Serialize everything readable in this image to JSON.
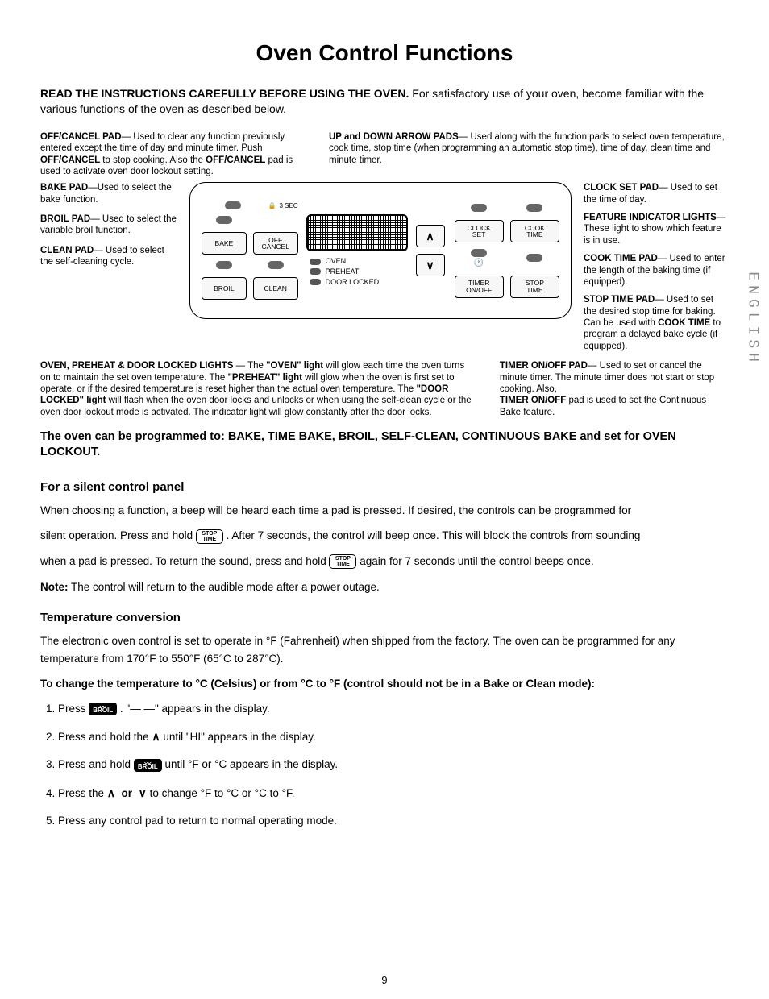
{
  "title": "Oven Control Functions",
  "intro_bold": "READ THE INSTRUCTIONS CAREFULLY BEFORE USING THE OVEN.",
  "intro_rest": " For satisfactory use of your oven, become familiar with the various functions of the oven as described below.",
  "top_row": {
    "off_cancel": {
      "label": "OFF/CANCEL PAD",
      "text": "— Used to clear any function previously entered except the time of day and minute timer. Push ",
      "b1": "OFF/CANCEL",
      "text2": " to stop cooking. Also the ",
      "b2": "OFF/CANCEL",
      "text3": " pad is used to activate oven door lockout setting."
    },
    "arrows": {
      "label": "UP and DOWN ARROW PADS",
      "text": "— Used along with the function pads to select oven temperature, cook time, stop time (when programming an automatic stop time), time of day, clean time and minute timer."
    }
  },
  "left": {
    "bake": {
      "label": "BAKE PAD",
      "text": "—Used to select the bake function."
    },
    "broil": {
      "label": "BROIL PAD",
      "text": "— Used to select the variable broil function."
    },
    "clean": {
      "label": "CLEAN PAD",
      "text": "— Used to select the self-cleaning cycle."
    }
  },
  "right": {
    "clock": {
      "label": "CLOCK SET PAD",
      "text": "— Used to set the time of day."
    },
    "feature": {
      "label": "FEATURE INDICATOR LIGHTS",
      "text": "— These light to show which feature is in use."
    },
    "cook": {
      "label": "COOK TIME PAD",
      "text": "— Used to enter the length of the baking time (if equipped)."
    },
    "stop": {
      "label": "STOP TIME PAD",
      "text": "— Used to set the desired stop time for baking. Can be used with ",
      "b": "COOK TIME",
      "text2": " to program a delayed bake cycle (if equipped)."
    }
  },
  "panel": {
    "pads": {
      "bake": "BAKE",
      "off": "OFF\nCANCEL",
      "broil": "BROIL",
      "clean": "CLEAN",
      "clock": "CLOCK\nSET",
      "cook": "COOK\nTIME",
      "timer": "TIMER\nON/OFF",
      "stop": "STOP\nTIME"
    },
    "sec_label": "3 SEC",
    "lights": {
      "oven": "OVEN",
      "preheat": "PREHEAT",
      "door": "DOOR LOCKED"
    }
  },
  "under": {
    "left": {
      "label": "OVEN, PREHEAT & DOOR LOCKED LIGHTS",
      "t1": " — The ",
      "b1": "\"OVEN\" light",
      "t2": " will glow each time the oven turns on to maintain the set oven temperature. The ",
      "b2": "\"PREHEAT\" light",
      "t3": " will glow when the oven is first set to operate, or if the desired temperature is reset higher than the actual oven temperature. The ",
      "b3": "\"DOOR LOCKED\" light",
      "t4": " will flash when the oven door locks and unlocks or when using the self-clean cycle or the oven door lockout mode is activated. The indicator light will glow constantly after the door locks."
    },
    "right": {
      "label": "TIMER ON/OFF PAD",
      "t1": "— Used to set or cancel the minute timer. The minute timer does not start or stop cooking. Also,",
      "br": "",
      "b1": "TIMER ON/OFF",
      "t2": " pad is used to set the Continuous Bake feature."
    }
  },
  "prog_line": "The oven can be programmed to: BAKE, TIME BAKE, BROIL, SELF-CLEAN, CONTINUOUS BAKE and set for OVEN LOCKOUT.",
  "silent": {
    "heading": "For a silent control panel",
    "p1a": "When choosing a function, a beep will be heard each time a pad is pressed. If desired, the controls can be programmed for",
    "p2a": "silent operation. Press and hold ",
    "p2b": ". After 7 seconds, the control will beep once. This will block the controls from sounding",
    "p3a": "when a pad is pressed. To return the sound, press and hold ",
    "p3b": " again for 7 seconds until the control beeps once.",
    "note_label": "Note:",
    "note": " The control will return to the audible mode after a power outage.",
    "st_top": "STOP",
    "st_bot": "TIME"
  },
  "temp": {
    "heading": "Temperature conversion",
    "p1": "The electronic oven control is set to operate in °F (Fahrenheit) when shipped from the factory. The oven can be programmed for any temperature from 170°F to 550°F (65°C to 287°C).",
    "bold_line": "To change the temperature to °C (Celsius) or from °C to °F (control should not be in a Bake or Clean mode):",
    "broil_label": "BROIL",
    "steps": {
      "s1a": "Press ",
      "s1b": ". \"— —\" appears in the display.",
      "s2a": "Press and hold the  ",
      "s2b": "  until \"HI\" appears in the display.",
      "s3a": "Press and hold ",
      "s3b": " until °F or °C appears in the display.",
      "s4a": "Press the  ",
      "s4or": "or",
      "s4b": "  to change °F to °C or °C to °F.",
      "s5": "Press any control pad to return to normal operating mode."
    }
  },
  "side_label": "ENGLISH",
  "page": "9"
}
